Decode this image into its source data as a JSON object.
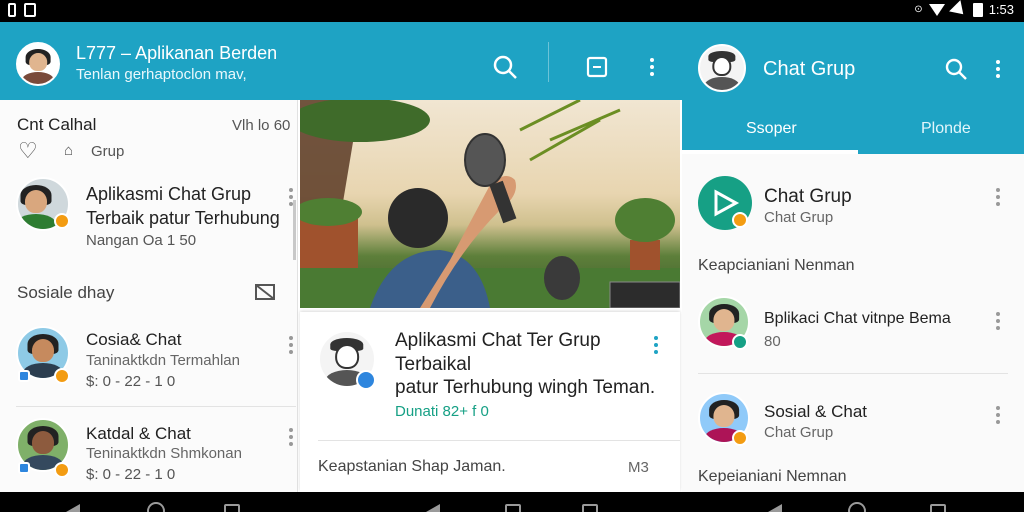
{
  "status_bar": {
    "time": "1:53"
  },
  "left_app": {
    "title": "L777 – Aplikanan Berden",
    "subtitle": "Tenlan gerhaptoclon mav,"
  },
  "left_list": {
    "header_label": "Cnt Calhal",
    "header_meta": "Vlh lo 60",
    "group_label": "Grup",
    "item1": {
      "line1": "Aplikasmi Chat Grup",
      "line2": "Terbaik patur Terhubung",
      "meta": "Nangan Oa 1 50"
    },
    "section_label": "Sosiale dhay",
    "item2": {
      "title": "Cosia& Chat",
      "subtitle": "Taninaktkdn Termahlan",
      "meta": "$: 0 - 22 - 1 0"
    },
    "item3": {
      "title": "Katdal & Chat",
      "subtitle": "Teninaktkdn Shmkonan",
      "meta": "$: 0 - 22 - 1 0"
    }
  },
  "middle": {
    "card": {
      "title1": "Aplikasmi Chat Ter Grup",
      "title2": "Terbaikal",
      "title3": "patur Terhubung wingh Teman.",
      "stat": "Dunati 82+ f 0",
      "footer_text": "Keapstanian Shap Jaman.",
      "footer_meta": "M3"
    }
  },
  "right_app": {
    "title": "Chat Grup",
    "tabs": [
      "Ssoper",
      "Plonde"
    ],
    "item1": {
      "title": "Chat Grup",
      "subtitle": "Chat Grup"
    },
    "section1": "Keapcianiani Nenman",
    "item2": {
      "title": "Bplikaci Chat vitnpe Bema",
      "subtitle": "80"
    },
    "item3": {
      "title": "Sosial & Chat",
      "subtitle": "Chat Grup"
    },
    "section2": "Kepeianiani Nemnan"
  },
  "colors": {
    "primary": "#1ea3c4",
    "accent_green": "#16a085",
    "badge": "#f39c12"
  }
}
